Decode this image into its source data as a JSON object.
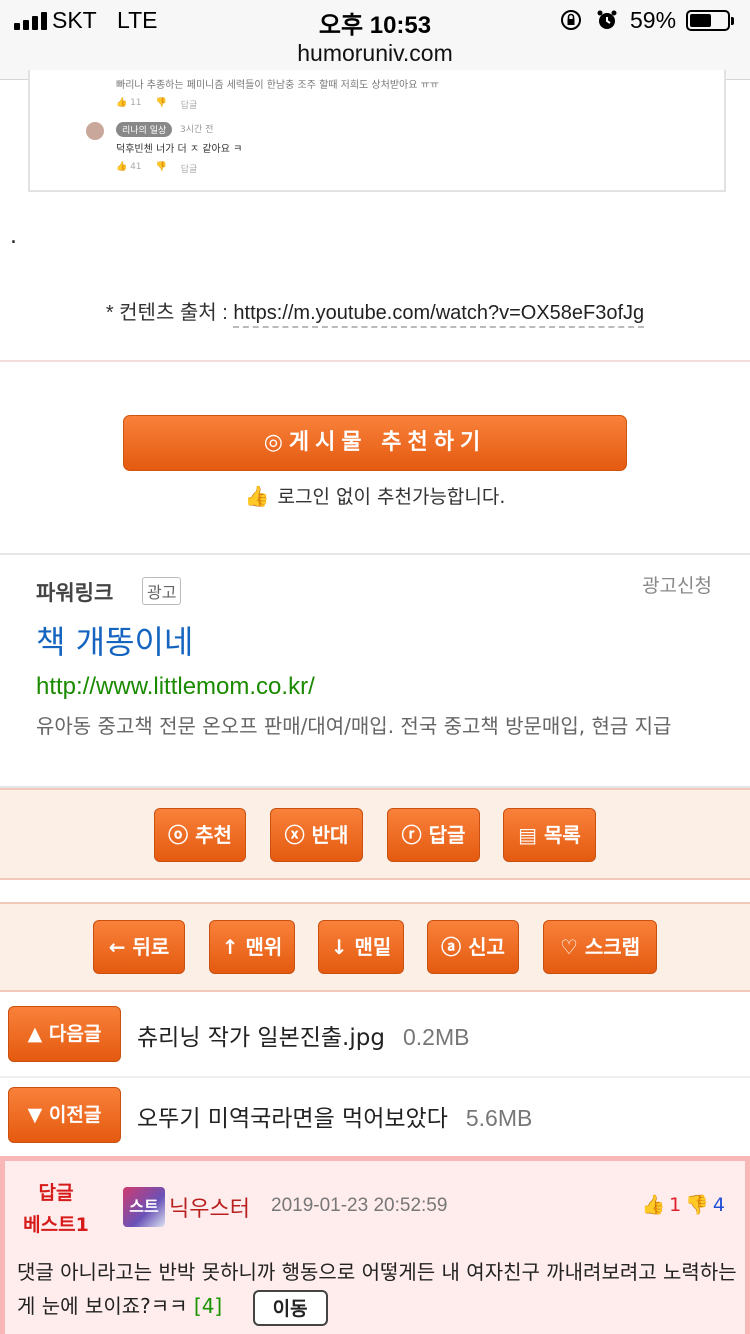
{
  "status_bar": {
    "carrier": "SKT",
    "network": "LTE",
    "time": "오후 10:53",
    "battery_pct": "59%",
    "battery_level": 0.59
  },
  "address_bar": {
    "url": "humoruniv.com"
  },
  "embedded_shot": {
    "line1": "빠리나 추종하는 페미니즘 세력들이 한남충 조주 할때 저희도 상처받아요 ㅠㅠ",
    "meta1_like": "11",
    "meta1_reply": "답글",
    "user_badge": "리나의 일상",
    "ago": "3시간 전",
    "reply_text": "덕후빈첸 너가 더 ㅈ 같아요 ㅋ",
    "meta2_like": "41",
    "meta2_reply": "답글"
  },
  "post": {
    "dot": ".",
    "source_label": "* 컨텐츠 출처 :",
    "source_url": "https://m.youtube.com/watch?v=OX58eF3ofJg"
  },
  "recommend": {
    "button_label": "◎게시물  추천하기",
    "note": "로그인 없이 추천가능합니다."
  },
  "ad": {
    "title": "파워링크",
    "badge": "광고",
    "apply": "광고신청",
    "headline": "책 개똥이네",
    "link": "http://www.littlemom.co.kr/",
    "description": "유아동 중고책 전문 온오프 판매/대여/매입. 전국 중고책 방문매입, 현금 지급"
  },
  "actions_1": {
    "recommend": "ⓞ 추천",
    "oppose": "ⓧ 반대",
    "reply": "ⓡ 답글",
    "list": "▤ 목록"
  },
  "actions_2": {
    "back": "← 뒤로",
    "top": "↑ 맨위",
    "bottom": "↓ 맨밑",
    "report": "ⓐ 신고",
    "scrap": "♡ 스크랩"
  },
  "navigation": {
    "next_label": "▲ 다음글",
    "next_title": "츄리닝 작가 일본진출.jpg",
    "next_size": "0.2MB",
    "prev_label": "▼ 이전글",
    "prev_title": "오뚜기 미역국라면을 먹어보았다",
    "prev_size": "5.6MB"
  },
  "best_comment": {
    "label_line1": "답글",
    "label_line2": "베스트1",
    "avatar_text": "스트",
    "nickname": "닉우스터",
    "date": "2019-01-23 20:52:59",
    "up_votes": "1",
    "down_votes": "4",
    "body": "댓글 아니라고는 반박 못하니까 행동으로 어떻게든 내 여자친구 까내려보려고 노력하는게 눈에 보이죠?ㅋㅋ",
    "reply_count": "[4]",
    "move_label": "이동"
  }
}
